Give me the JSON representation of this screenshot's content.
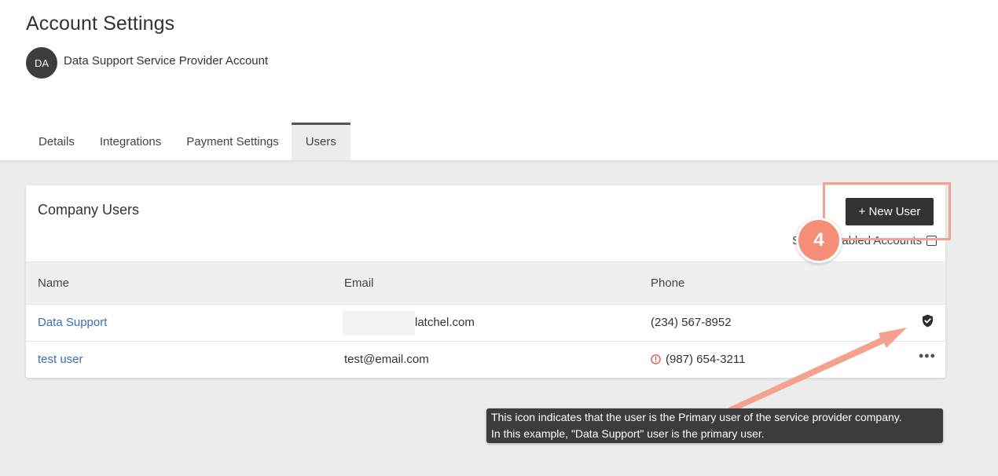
{
  "header": {
    "title": "Account Settings",
    "avatar_initials": "DA",
    "account_name": "Data Support Service Provider Account"
  },
  "tabs": [
    {
      "label": "Details",
      "active": false
    },
    {
      "label": "Integrations",
      "active": false
    },
    {
      "label": "Payment Settings",
      "active": false
    },
    {
      "label": "Users",
      "active": true
    }
  ],
  "company_users": {
    "title": "Company Users",
    "new_user_label": "+ New User",
    "show_disabled_label": "Show Disabled Accounts",
    "columns": [
      "Name",
      "Email",
      "Phone"
    ],
    "rows": [
      {
        "name": "Data Support",
        "email": "latchel.com",
        "phone": "(234) 567-8952",
        "icon": "shield-check-icon"
      },
      {
        "name": "test user",
        "email": "test@email.com",
        "phone": "(987) 654-3211",
        "phone_icon": "warning-circle-icon",
        "icon": "more-options-icon",
        "more_label": "•••"
      }
    ]
  },
  "annotation": {
    "step_number": "4",
    "tooltip_line1": "This icon indicates that the user is the Primary user of the service provider company.",
    "tooltip_line2": "In this example, \"Data Support\" user is the primary user.",
    "accent_color": "#f58f78"
  },
  "colors": {
    "link": "#3a6db5",
    "primary_button": "#333333",
    "warning": "#d9534f"
  }
}
